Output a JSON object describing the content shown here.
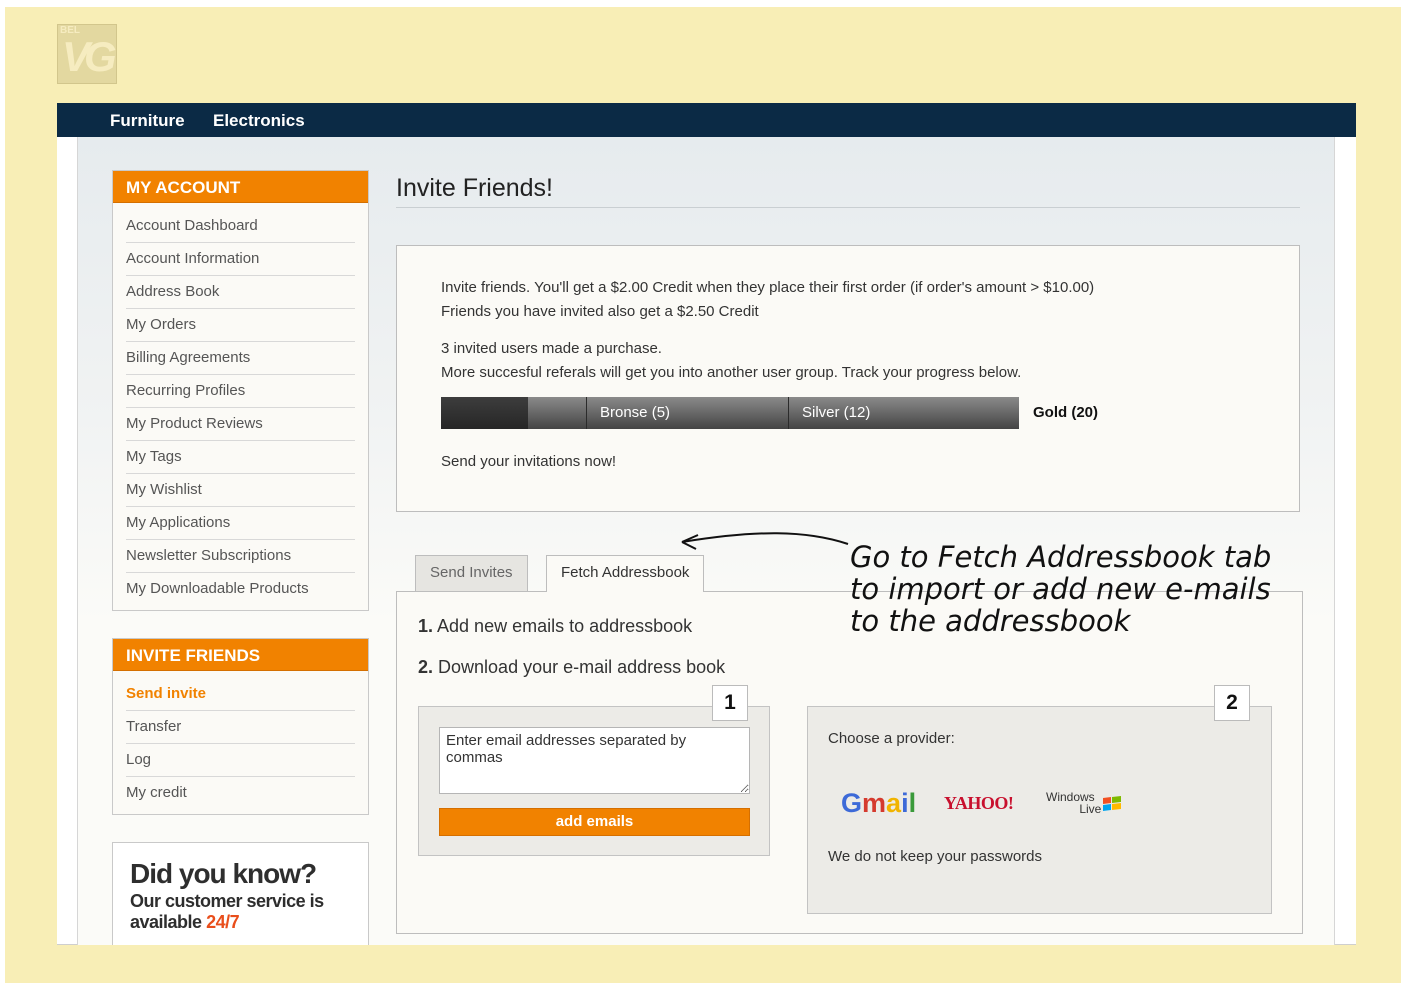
{
  "logo": {
    "top_text": "BEL",
    "mark": "VG"
  },
  "topnav": {
    "items": [
      "Furniture",
      "Electronics"
    ]
  },
  "sidebar": {
    "account": {
      "title": "MY ACCOUNT",
      "items": [
        "Account Dashboard",
        "Account Information",
        "Address Book",
        "My Orders",
        "Billing Agreements",
        "Recurring Profiles",
        "My Product Reviews",
        "My Tags",
        "My Wishlist",
        "My Applications",
        "Newsletter Subscriptions",
        "My Downloadable Products"
      ]
    },
    "invite": {
      "title": "INVITE FRIENDS",
      "items": [
        "Send invite",
        "Transfer",
        "Log",
        "My credit"
      ],
      "active": "Send invite"
    },
    "did_you_know": {
      "title": "Did you know?",
      "text": "Our customer service is available",
      "accent": "24/7"
    }
  },
  "main": {
    "title": "Invite Friends!",
    "info": {
      "line1": "Invite friends. You'll get a $2.00 Credit when they place their first order (if order's amount > $10.00)",
      "line2": "Friends you have invited also get a $2.50 Credit",
      "line3": "3 invited users made a purchase.",
      "line4": "More succesful referals will get you into another user group. Track your progress below.",
      "progress": {
        "current": 3,
        "levels": [
          {
            "name": "Bronse (5)",
            "threshold": 5
          },
          {
            "name": "Silver (12)",
            "threshold": 12
          },
          {
            "name": "Gold (20)",
            "threshold": 20
          }
        ]
      },
      "line5": "Send your invitations now!"
    },
    "tabs": [
      {
        "label": "Send Invites",
        "active": false
      },
      {
        "label": "Fetch Addressbook",
        "active": true
      }
    ],
    "steps": {
      "step1_num": "1.",
      "step1_text": "Add new emails to addressbook",
      "step2_num": "2.",
      "step2_text": "Download your e-mail address book"
    },
    "box1": {
      "badge": "1",
      "textarea_value": "Enter email addresses separated by commas",
      "button": "add emails"
    },
    "box2": {
      "badge": "2",
      "label": "Choose a provider:",
      "providers": [
        "Gmail",
        "YAHOO!",
        "Windows Live"
      ],
      "note": "We do not keep your passwords"
    }
  },
  "annotation": {
    "line1": "Go to Fetch Addressbook tab",
    "line2": "to import or add new e-mails",
    "line3": "to the addressbook"
  },
  "colors": {
    "background": "#f8eeb6",
    "nav": "#0b2a45",
    "accent": "#f18200",
    "promo_accent": "#e94e1b"
  }
}
